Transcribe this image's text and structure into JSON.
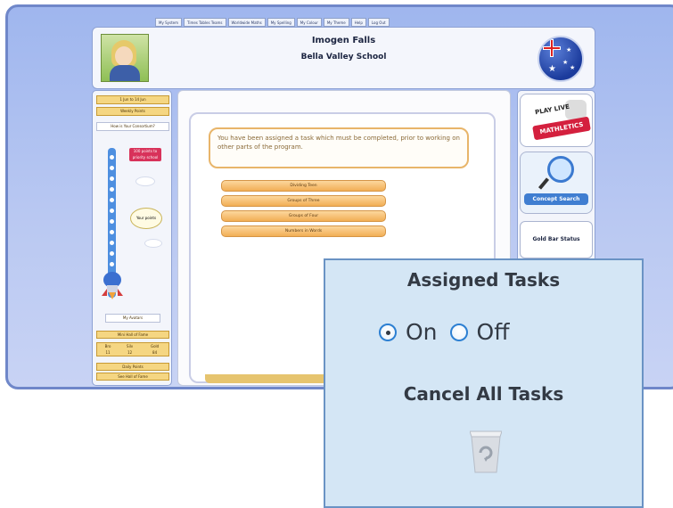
{
  "top_nav": [
    "My System",
    "Times Tables Teams",
    "Worldwide Maths",
    "My Spelling",
    "My Colour",
    "My Theme",
    "Help",
    "Log Out"
  ],
  "header": {
    "student_name": "Imogen Falls",
    "school_name": "Bella Valley School"
  },
  "left_panel": {
    "date_box": "1 Jun to 14 Jun",
    "weekly_points": "Weekly Points",
    "how_is_consortium": "How is Your Consortium?",
    "tag": "100 points to priority school",
    "bubble": "Your points",
    "my_avatars": "My Avatars",
    "hall_of_fame": "Mini Hall of Fame",
    "stats_headers": [
      "Bro",
      "Silv",
      "Gold"
    ],
    "stats_values": [
      "11",
      "12",
      "84"
    ],
    "daily_points": "Daily Points",
    "see_hall": "See Hall of Fame"
  },
  "main": {
    "message": "You have been assigned a task which must be completed, prior to working on other parts of the program.",
    "tasks": [
      "Dividing Teen",
      "Groups of Three",
      "Groups of Four",
      "Numbers in Words"
    ]
  },
  "right_panel": {
    "promo1": "PLAY LIVE",
    "promo1_badge": "MATHLETICS",
    "promo2": "Concept Search",
    "gold_status": "Gold Bar Status"
  },
  "popup": {
    "title": "Assigned Tasks",
    "option_on": "On",
    "option_off": "Off",
    "selected": "On",
    "cancel_title": "Cancel All Tasks",
    "bin_icon": "recycle-bin-icon"
  }
}
